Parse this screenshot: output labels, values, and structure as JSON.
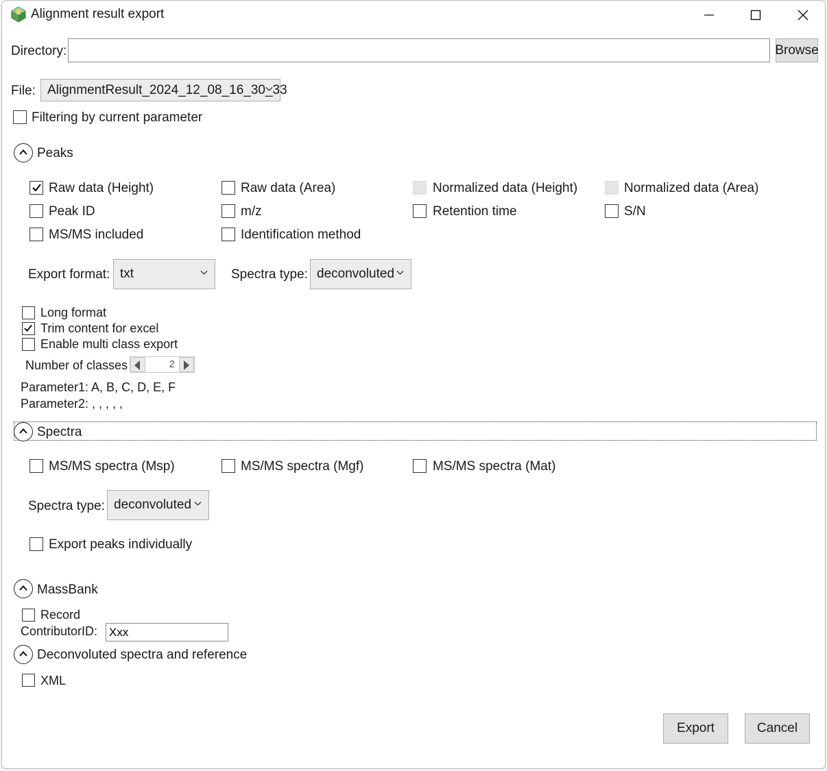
{
  "window": {
    "title": "Alignment result export"
  },
  "directory": {
    "label": "Directory:",
    "value": "",
    "browse_label": "Browse"
  },
  "file": {
    "label": "File:",
    "selected": "AlignmentResult_2024_12_08_16_30_33"
  },
  "filtering": {
    "label": "Filtering by current parameter",
    "checked": false
  },
  "peaks": {
    "header": "Peaks",
    "options": [
      {
        "label": "Raw data (Height)",
        "checked": true,
        "enabled": true
      },
      {
        "label": "Raw data (Area)",
        "checked": false,
        "enabled": true
      },
      {
        "label": "Normalized data (Height)",
        "checked": false,
        "enabled": false
      },
      {
        "label": "Normalized data (Area)",
        "checked": false,
        "enabled": false
      },
      {
        "label": "Peak ID",
        "checked": false,
        "enabled": true
      },
      {
        "label": "m/z",
        "checked": false,
        "enabled": true
      },
      {
        "label": "Retention time",
        "checked": false,
        "enabled": true
      },
      {
        "label": "S/N",
        "checked": false,
        "enabled": true
      },
      {
        "label": "MS/MS included",
        "checked": false,
        "enabled": true
      },
      {
        "label": "Identification method",
        "checked": false,
        "enabled": true
      }
    ],
    "export_format_label": "Export format:",
    "export_format_value": "txt",
    "spectra_type_label": "Spectra type:",
    "spectra_type_value": "deconvoluted",
    "long_format_label": "Long format",
    "long_format_checked": false,
    "trim_label": "Trim content for excel",
    "trim_checked": true,
    "multi_class_label": "Enable multi class export",
    "multi_class_checked": false,
    "num_classes_label": "Number of classes",
    "num_classes_value": "2",
    "parameter1": "Parameter1: A, B, C, D, E, F",
    "parameter2": "Parameter2: , , , , ,"
  },
  "spectra": {
    "header": "Spectra",
    "options": [
      {
        "label": "MS/MS spectra (Msp)",
        "checked": false
      },
      {
        "label": "MS/MS spectra (Mgf)",
        "checked": false
      },
      {
        "label": "MS/MS spectra (Mat)",
        "checked": false
      }
    ],
    "spectra_type_label": "Spectra type:",
    "spectra_type_value": "deconvoluted",
    "export_individually_label": "Export peaks individually",
    "export_individually_checked": false
  },
  "massbank": {
    "header": "MassBank",
    "record_label": "Record",
    "record_checked": false,
    "contributor_label": "ContributorID:",
    "contributor_value": "Xxx"
  },
  "deconvoluted": {
    "header": "Deconvoluted spectra and reference",
    "xml_label": "XML",
    "xml_checked": false
  },
  "actions": {
    "export_label": "Export",
    "cancel_label": "Cancel"
  },
  "colors": {
    "window_bg": "#ffffff",
    "button_bg": "#e1e1e1",
    "check_color": "#000000",
    "disabled_cb": "#e5e5e5"
  }
}
